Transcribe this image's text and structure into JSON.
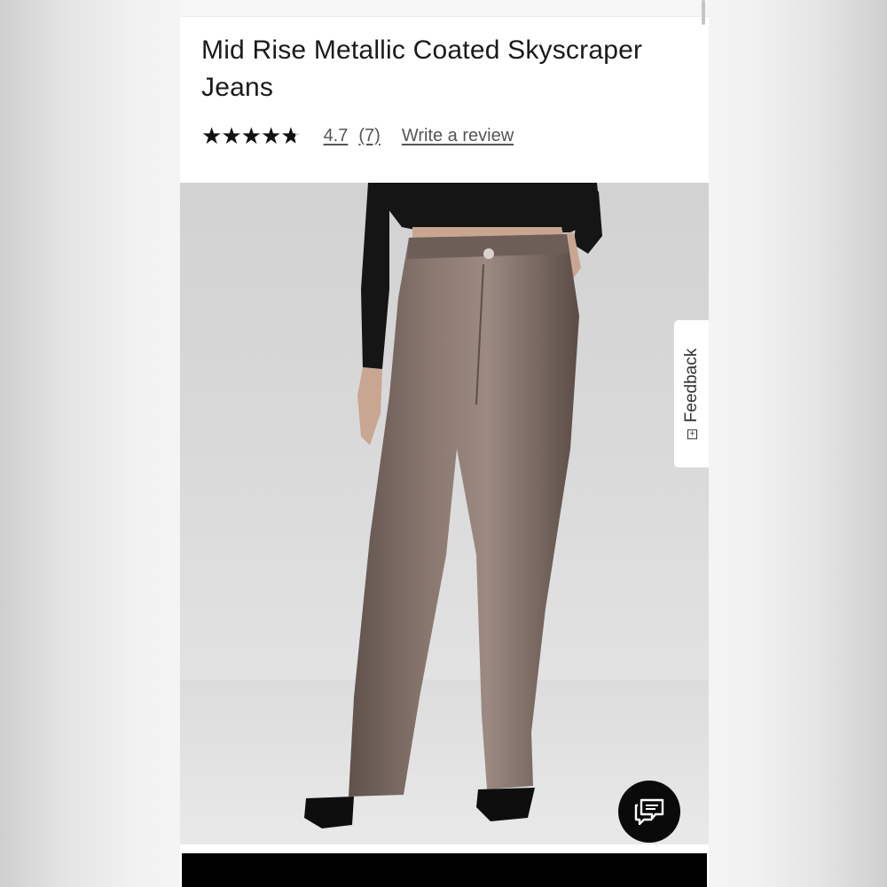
{
  "product": {
    "title": "Mid Rise Metallic Coated Skyscraper Jeans"
  },
  "rating": {
    "stars_value": 4.7,
    "value_text": "4.7",
    "count_text": "(7)",
    "write_review_label": "Write a review"
  },
  "image": {
    "subject": "model wearing metallic coated bootcut jeans",
    "pants_color": "#7a6a63",
    "top_color": "#151515"
  },
  "feedback_tab": {
    "label": "Feedback",
    "icon": "plus-box-icon"
  },
  "chat_button": {
    "icon": "chat-bubbles-icon"
  },
  "colors": {
    "page_background": "#ffffff",
    "text": "#1a1a1a",
    "link": "#555555",
    "chat_button": "#0a0a0a"
  }
}
